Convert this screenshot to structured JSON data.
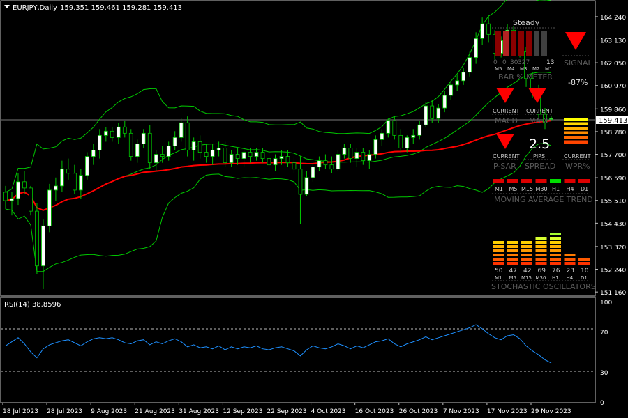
{
  "chart_title": "EURJPY,Daily",
  "ohlc_text": "159.351 159.461 159.281 159.413",
  "current_price": 159.413,
  "price_axis_labels": [
    "164.240",
    "163.130",
    "162.050",
    "160.970",
    "159.860",
    "158.780",
    "157.700",
    "156.590",
    "155.510",
    "154.430",
    "153.320",
    "152.240",
    "151.160"
  ],
  "date_labels": [
    "18 Jul 2023",
    "28 Jul 2023",
    "9 Aug 2023",
    "21 Aug 2023",
    "31 Aug 2023",
    "12 Sep 2023",
    "22 Sep 2023",
    "4 Oct 2023",
    "16 Oct 2023",
    "26 Oct 2023",
    "7 Nov 2023",
    "17 Nov 2023",
    "29 Nov 2023"
  ],
  "rsi": {
    "label": "RSI(14) 38.8596",
    "axis_labels": [
      "100",
      "70",
      "30",
      "0"
    ]
  },
  "colors": {
    "bull_candle": "#ffffff",
    "bear_candle": "#000000",
    "wick": "#00c800",
    "bands": "#00c800",
    "ma": "#ff0000",
    "rsi_line": "#1e90ff",
    "panel_text": "#5a5a5a",
    "arrow_red": "#ff0000"
  },
  "panel": {
    "steady_label": "Steady",
    "bar_meter_title": "BAR % METER",
    "bar_meter_values": [
      "0",
      "0",
      "30",
      "327",
      "",
      "13"
    ],
    "bar_meter_timeframes": [
      "M5",
      "M4",
      "M3",
      "M2",
      "M1"
    ],
    "signal_label": "SIGNAL",
    "percent_value": "-87%",
    "macd_label": "MACD",
    "mac_label": "MA-X",
    "psar_label": "P-SAR",
    "spread_label": "SPREAD",
    "wpr_label": "WPR%",
    "current_label": "CURRENT",
    "pips_label": "PIPS",
    "spread_value": "2.5",
    "ma_trend_title": "MOVING AVERAGE TREND",
    "timeframes": [
      "M1",
      "M5",
      "M15",
      "M30",
      "H1",
      "H4",
      "D1"
    ],
    "stoch_title": "STOCHASTIC OSCILLATORS",
    "stoch_values": [
      "50",
      "47",
      "42",
      "69",
      "76",
      "23",
      "10"
    ]
  },
  "chart_data": {
    "type": "candlestick",
    "title": "EURJPY,Daily",
    "ylim": [
      151.0,
      164.9
    ],
    "candles": [
      [
        155.9,
        156.2,
        155.1,
        155.5
      ],
      [
        155.5,
        155.9,
        154.8,
        155.6
      ],
      [
        155.6,
        156.8,
        155.3,
        156.4
      ],
      [
        156.4,
        156.9,
        155.8,
        156.1
      ],
      [
        156.1,
        156.2,
        154.8,
        155.0
      ],
      [
        155.0,
        155.4,
        152.0,
        152.4
      ],
      [
        152.4,
        154.6,
        151.3,
        154.3
      ],
      [
        154.3,
        156.3,
        154.0,
        156.0
      ],
      [
        156.0,
        156.6,
        155.5,
        156.2
      ],
      [
        156.2,
        157.4,
        155.9,
        157.0
      ],
      [
        157.0,
        157.5,
        156.5,
        156.8
      ],
      [
        156.8,
        157.2,
        155.8,
        156.0
      ],
      [
        156.0,
        157.0,
        155.6,
        156.7
      ],
      [
        156.7,
        157.8,
        156.5,
        157.6
      ],
      [
        157.6,
        158.2,
        157.2,
        157.9
      ],
      [
        157.9,
        158.9,
        157.5,
        158.6
      ],
      [
        158.6,
        159.0,
        158.3,
        158.8
      ],
      [
        158.8,
        159.0,
        158.3,
        158.5
      ],
      [
        158.5,
        159.2,
        158.2,
        159.0
      ],
      [
        159.0,
        159.3,
        158.5,
        158.7
      ],
      [
        158.7,
        158.9,
        157.4,
        157.6
      ],
      [
        157.6,
        158.4,
        157.3,
        158.2
      ],
      [
        158.2,
        158.9,
        158.0,
        158.7
      ],
      [
        158.7,
        159.1,
        157.0,
        157.3
      ],
      [
        157.3,
        157.9,
        156.9,
        157.7
      ],
      [
        157.7,
        158.1,
        157.3,
        157.6
      ],
      [
        157.6,
        158.3,
        157.4,
        158.1
      ],
      [
        158.1,
        158.8,
        157.9,
        158.5
      ],
      [
        158.5,
        159.4,
        158.3,
        159.2
      ],
      [
        159.2,
        159.5,
        157.6,
        157.9
      ],
      [
        157.9,
        158.5,
        157.4,
        158.3
      ],
      [
        158.3,
        158.6,
        157.5,
        157.8
      ],
      [
        157.8,
        158.2,
        157.3,
        157.6
      ],
      [
        157.6,
        158.2,
        157.2,
        157.9
      ],
      [
        157.9,
        158.3,
        157.6,
        158.0
      ],
      [
        158.0,
        158.3,
        157.1,
        157.3
      ],
      [
        157.3,
        157.9,
        157.1,
        157.7
      ],
      [
        157.7,
        158.0,
        157.2,
        157.5
      ],
      [
        157.5,
        157.9,
        157.1,
        157.8
      ],
      [
        157.8,
        158.0,
        157.3,
        157.6
      ],
      [
        157.6,
        158.0,
        157.4,
        157.8
      ],
      [
        157.8,
        158.0,
        157.3,
        157.5
      ],
      [
        157.5,
        157.8,
        156.9,
        157.2
      ],
      [
        157.2,
        157.7,
        156.9,
        157.5
      ],
      [
        157.5,
        157.9,
        157.2,
        157.6
      ],
      [
        157.6,
        157.9,
        157.1,
        157.3
      ],
      [
        157.3,
        157.6,
        156.8,
        157.0
      ],
      [
        157.0,
        157.6,
        154.4,
        155.8
      ],
      [
        155.8,
        156.9,
        155.7,
        156.6
      ],
      [
        156.6,
        157.3,
        156.4,
        157.1
      ],
      [
        157.1,
        157.6,
        156.9,
        157.4
      ],
      [
        157.4,
        157.7,
        157.0,
        157.2
      ],
      [
        157.2,
        157.6,
        156.8,
        157.0
      ],
      [
        157.0,
        157.9,
        156.9,
        157.7
      ],
      [
        157.7,
        158.2,
        157.5,
        158.0
      ],
      [
        158.0,
        158.2,
        157.3,
        157.5
      ],
      [
        157.5,
        158.0,
        157.1,
        157.8
      ],
      [
        157.8,
        158.0,
        157.2,
        157.4
      ],
      [
        157.4,
        157.9,
        157.0,
        157.7
      ],
      [
        157.7,
        158.6,
        157.5,
        158.4
      ],
      [
        158.4,
        158.9,
        158.1,
        158.7
      ],
      [
        158.7,
        159.4,
        158.5,
        159.3
      ],
      [
        159.3,
        159.5,
        158.4,
        158.6
      ],
      [
        158.6,
        158.9,
        157.8,
        158.0
      ],
      [
        158.0,
        158.6,
        157.8,
        158.5
      ],
      [
        158.5,
        158.9,
        158.2,
        158.6
      ],
      [
        158.6,
        159.3,
        158.4,
        159.1
      ],
      [
        159.1,
        160.2,
        159.0,
        160.0
      ],
      [
        160.0,
        160.3,
        159.2,
        159.4
      ],
      [
        159.4,
        160.1,
        159.2,
        159.9
      ],
      [
        159.9,
        160.7,
        159.7,
        160.5
      ],
      [
        160.5,
        161.2,
        160.3,
        161.0
      ],
      [
        161.0,
        161.5,
        160.7,
        161.2
      ],
      [
        161.2,
        161.8,
        161.0,
        161.6
      ],
      [
        161.6,
        162.6,
        161.4,
        162.3
      ],
      [
        162.3,
        163.5,
        162.0,
        163.2
      ],
      [
        163.2,
        164.2,
        162.9,
        163.9
      ],
      [
        163.9,
        164.3,
        163.0,
        163.4
      ],
      [
        163.4,
        163.6,
        162.2,
        162.5
      ],
      [
        162.5,
        163.3,
        162.3,
        163.1
      ],
      [
        163.1,
        163.9,
        162.7,
        163.6
      ],
      [
        163.6,
        163.8,
        162.9,
        163.1
      ],
      [
        163.1,
        163.4,
        162.3,
        162.6
      ],
      [
        162.6,
        162.8,
        160.9,
        161.3
      ],
      [
        161.3,
        161.6,
        160.4,
        160.7
      ],
      [
        160.7,
        161.0,
        159.4,
        159.6
      ],
      [
        159.6,
        159.9,
        158.9,
        159.2
      ],
      [
        159.4,
        159.5,
        159.3,
        159.4
      ]
    ],
    "rsi_values": [
      56,
      60,
      64,
      58,
      50,
      44,
      53,
      57,
      59,
      61,
      62,
      59,
      56,
      60,
      63,
      64,
      63,
      64,
      62,
      59,
      58,
      61,
      62,
      57,
      60,
      58,
      61,
      63,
      60,
      55,
      57,
      54,
      55,
      53,
      56,
      52,
      55,
      53,
      55,
      54,
      56,
      53,
      52,
      54,
      55,
      53,
      51,
      46,
      52,
      56,
      54,
      53,
      55,
      58,
      56,
      53,
      56,
      54,
      57,
      60,
      61,
      63,
      58,
      55,
      58,
      60,
      62,
      65,
      62,
      64,
      66,
      68,
      70,
      72,
      74,
      77,
      73,
      68,
      64,
      62,
      66,
      67,
      63,
      56,
      51,
      47,
      42,
      38.9
    ],
    "rsi_ylim": [
      0,
      100
    ]
  }
}
